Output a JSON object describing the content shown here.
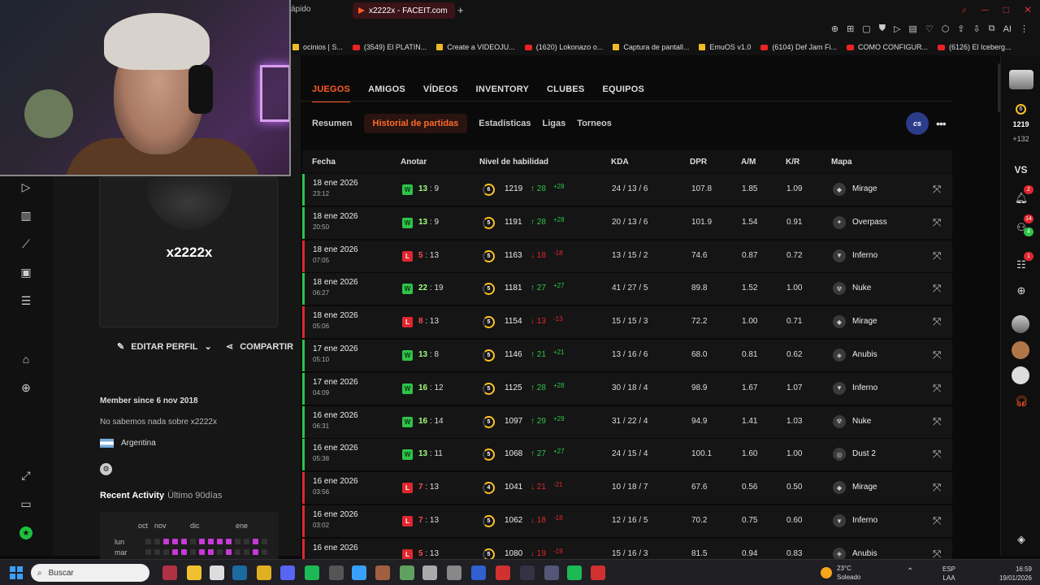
{
  "browser": {
    "prev_tab": "ápido",
    "active_tab": "x2222x - FACEIT.com",
    "new_tab": "+",
    "toolbar_ai": "AI",
    "bookmarks": [
      {
        "label": "ocinios | S...",
        "icon": "generic"
      },
      {
        "label": "(3549) El PLATIN...",
        "icon": "youtube"
      },
      {
        "label": "Create a VIDEOJU...",
        "icon": "generic"
      },
      {
        "label": "(1620) Lokonazo o...",
        "icon": "youtube"
      },
      {
        "label": "Captura de pantall...",
        "icon": "generic"
      },
      {
        "label": "EmuOS v1.0",
        "icon": "generic"
      },
      {
        "label": "(6104) Def Jam Fi...",
        "icon": "youtube"
      },
      {
        "label": "COMO CONFIGUR...",
        "icon": "youtube"
      },
      {
        "label": "(6126) El Iceberg...",
        "icon": "youtube"
      }
    ]
  },
  "profile": {
    "name": "x2222x",
    "edit_label": "EDITAR PERFIL",
    "share_label": "COMPARTIR",
    "member_since": "Member since 6 nov 2018",
    "about": "No sabemos nada sobre x2222x",
    "country": "Argentina",
    "recent_title": "Recent Activity",
    "recent_range": "Último 90días",
    "months": [
      "oct",
      "nov",
      "dic",
      "ene"
    ],
    "days": [
      "lun",
      "mar"
    ]
  },
  "main_nav": [
    "JUEGOS",
    "AMIGOS",
    "VÍDEOS",
    "INVENTORY",
    "CLUBES",
    "EQUIPOS"
  ],
  "sub_nav": [
    "Resumen",
    "Historial de partidas",
    "Estadísticas",
    "Ligas",
    "Torneos"
  ],
  "game_badge": "cs",
  "table": {
    "headers": [
      "Fecha",
      "Anotar",
      "Nivel de habilidad",
      "KDA",
      "DPR",
      "A/M",
      "K/R",
      "Mapa"
    ],
    "rows": [
      {
        "date": "18 ene 2026",
        "time": "23:12",
        "result": "W",
        "s1": "13",
        "s2": "9",
        "lvl": "6",
        "elo": "1219",
        "d": "28",
        "ds": "+28",
        "up": true,
        "kda": "24 / 13 / 6",
        "dpr": "107.8",
        "am": "1.85",
        "kr": "1.09",
        "map": "Mirage"
      },
      {
        "date": "18 ene 2026",
        "time": "20:50",
        "result": "W",
        "s1": "13",
        "s2": "9",
        "lvl": "5",
        "elo": "1191",
        "d": "28",
        "ds": "+28",
        "up": true,
        "kda": "20 / 13 / 6",
        "dpr": "101.9",
        "am": "1.54",
        "kr": "0.91",
        "map": "Overpass"
      },
      {
        "date": "18 ene 2026",
        "time": "07:05",
        "result": "L",
        "s1": "5",
        "s2": "13",
        "lvl": "5",
        "elo": "1163",
        "d": "18",
        "ds": "-18",
        "up": false,
        "kda": "13 / 15 / 2",
        "dpr": "74.6",
        "am": "0.87",
        "kr": "0.72",
        "map": "Inferno"
      },
      {
        "date": "18 ene 2026",
        "time": "06:27",
        "result": "W",
        "s1": "22",
        "s2": "19",
        "lvl": "5",
        "elo": "1181",
        "d": "27",
        "ds": "+27",
        "up": true,
        "kda": "41 / 27 / 5",
        "dpr": "89.8",
        "am": "1.52",
        "kr": "1.00",
        "map": "Nuke"
      },
      {
        "date": "18 ene 2026",
        "time": "05:06",
        "result": "L",
        "s1": "8",
        "s2": "13",
        "lvl": "5",
        "elo": "1154",
        "d": "13",
        "ds": "-13",
        "up": false,
        "kda": "15 / 15 / 3",
        "dpr": "72.2",
        "am": "1.00",
        "kr": "0.71",
        "map": "Mirage"
      },
      {
        "date": "17 ene 2026",
        "time": "05:10",
        "result": "W",
        "s1": "13",
        "s2": "8",
        "lvl": "5",
        "elo": "1146",
        "d": "21",
        "ds": "+21",
        "up": true,
        "kda": "13 / 16 / 6",
        "dpr": "68.0",
        "am": "0.81",
        "kr": "0.62",
        "map": "Anubis"
      },
      {
        "date": "17 ene 2026",
        "time": "04:09",
        "result": "W",
        "s1": "16",
        "s2": "12",
        "lvl": "5",
        "elo": "1125",
        "d": "28",
        "ds": "+28",
        "up": true,
        "kda": "30 / 18 / 4",
        "dpr": "98.9",
        "am": "1.67",
        "kr": "1.07",
        "map": "Inferno"
      },
      {
        "date": "16 ene 2026",
        "time": "06:31",
        "result": "W",
        "s1": "16",
        "s2": "14",
        "lvl": "5",
        "elo": "1097",
        "d": "29",
        "ds": "+29",
        "up": true,
        "kda": "31 / 22 / 4",
        "dpr": "94.9",
        "am": "1.41",
        "kr": "1.03",
        "map": "Nuke"
      },
      {
        "date": "16 ene 2026",
        "time": "05:38",
        "result": "W",
        "s1": "13",
        "s2": "11",
        "lvl": "5",
        "elo": "1068",
        "d": "27",
        "ds": "+27",
        "up": true,
        "kda": "24 / 15 / 4",
        "dpr": "100.1",
        "am": "1.60",
        "kr": "1.00",
        "map": "Dust 2"
      },
      {
        "date": "16 ene 2026",
        "time": "03:56",
        "result": "L",
        "s1": "7",
        "s2": "13",
        "lvl": "4",
        "elo": "1041",
        "d": "21",
        "ds": "-21",
        "up": false,
        "kda": "10 / 18 / 7",
        "dpr": "67.6",
        "am": "0.56",
        "kr": "0.50",
        "map": "Mirage"
      },
      {
        "date": "16 ene 2026",
        "time": "03:02",
        "result": "L",
        "s1": "7",
        "s2": "13",
        "lvl": "5",
        "elo": "1062",
        "d": "18",
        "ds": "-18",
        "up": false,
        "kda": "12 / 16 / 5",
        "dpr": "70.2",
        "am": "0.75",
        "kr": "0.60",
        "map": "Inferno"
      },
      {
        "date": "16 ene 2026",
        "time": "",
        "result": "L",
        "s1": "5",
        "s2": "13",
        "lvl": "5",
        "elo": "1080",
        "d": "19",
        "ds": "-19",
        "up": false,
        "kda": "15 / 16 / 3",
        "dpr": "81.5",
        "am": "0.94",
        "kr": "0.83",
        "map": "Anubis"
      }
    ]
  },
  "rail": {
    "level": "6",
    "elo": "1219",
    "elo_plus": "+132",
    "vs": "VS",
    "notif_count": "2",
    "friends_count": "14",
    "friends_online": "4",
    "party_count": "1"
  },
  "taskbar": {
    "search": "Buscar",
    "temp": "23°C",
    "weather": "Soleado",
    "lang1": "ESP",
    "lang2": "LAA",
    "time": "16:59",
    "date": "19/01/2026"
  },
  "colors": {
    "accent": "#ff5a24",
    "win": "#2ec44a",
    "loss": "#e0262f",
    "level": "#ffc222"
  }
}
